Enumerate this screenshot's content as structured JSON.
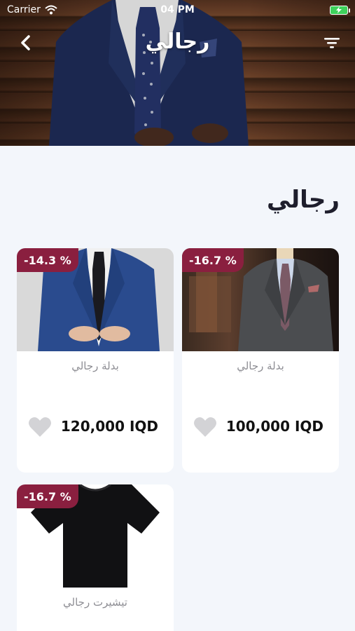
{
  "status_bar": {
    "carrier": "Carrier",
    "time": "04 PM"
  },
  "nav": {
    "title": "رجالي",
    "back_icon": "chevron-left-icon",
    "filter_icon": "filter-icon"
  },
  "section": {
    "title": "رجالي"
  },
  "colors": {
    "discount_badge": "#8a1f3f",
    "background": "#f3f6fb",
    "battery": "#3ed15b"
  },
  "products": [
    {
      "name": "بدلة رجالي",
      "price": "100,000 IQD",
      "discount": "-16.7 %"
    },
    {
      "name": "بدلة رجالي",
      "price": "120,000 IQD",
      "discount": "-14.3 %"
    },
    {
      "name": "تيشيرت رجالي",
      "discount": "-16.7 %"
    }
  ]
}
